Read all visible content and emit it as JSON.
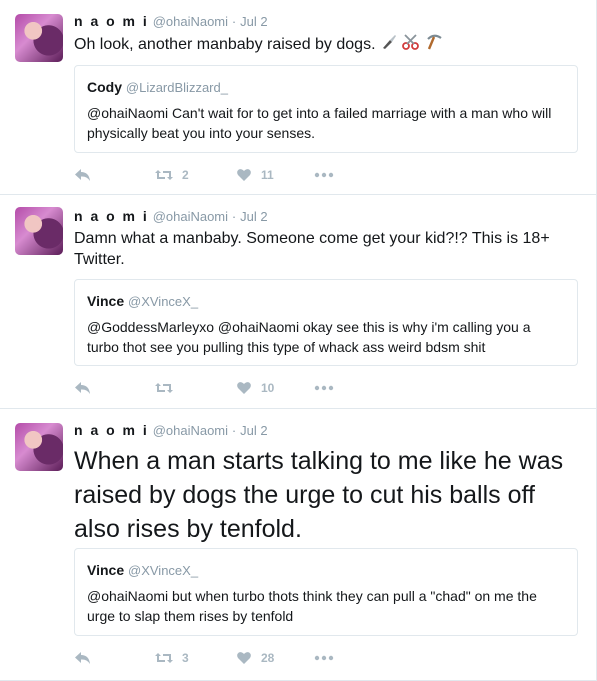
{
  "colors": {
    "icon_grey": "#aab8c2",
    "border": "#e1e8ed",
    "text_secondary": "#8899a6"
  },
  "tweets": [
    {
      "name": "n a o m i",
      "handle": "@ohaiNaomi",
      "separator": "·",
      "date": "Jul 2",
      "text": "Oh look, another manbaby raised by dogs.",
      "emojis": [
        "knife-icon",
        "scissors-icon",
        "pick-icon"
      ],
      "quote": {
        "name": "Cody",
        "handle": "@LizardBlizzard_",
        "text": "@ohaiNaomi Can't wait for to get into a failed marriage with a man who will physically beat you into your senses."
      },
      "actions": {
        "reply_icon": "reply-icon",
        "retweet_count": "2",
        "like_count": "11"
      }
    },
    {
      "name": "n a o m i",
      "handle": "@ohaiNaomi",
      "separator": "·",
      "date": "Jul 2",
      "text": "Damn what a manbaby. Someone come get your kid?!? This is 18+ Twitter.",
      "quote": {
        "name": "Vince",
        "handle": "@XVinceX_",
        "text": "@GoddessMarleyxo @ohaiNaomi okay see this is why i'm calling you a turbo thot see you pulling this type of whack ass weird bdsm shit"
      },
      "actions": {
        "retweet_count": "",
        "like_count": "10"
      }
    },
    {
      "name": "n a o m i",
      "handle": "@ohaiNaomi",
      "separator": "·",
      "date": "Jul 2",
      "text": "When a man starts talking to me like he was raised by dogs the urge to cut his balls off also rises by tenfold.",
      "quote": {
        "name": "Vince",
        "handle": "@XVinceX_",
        "text": "@ohaiNaomi but when turbo thots think they can pull a \"chad\" on me the urge to slap them rises by tenfold"
      },
      "actions": {
        "retweet_count": "3",
        "like_count": "28"
      }
    }
  ]
}
